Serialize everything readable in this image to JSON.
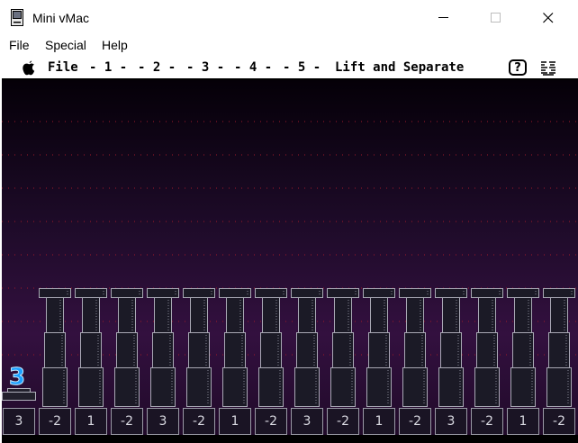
{
  "window": {
    "title": "Mini vMac",
    "minimize_glyph": "—",
    "maximize_glyph": "☐",
    "close_glyph": "✕"
  },
  "menubar": {
    "items": [
      "File",
      "Special",
      "Help"
    ]
  },
  "mac_menubar": {
    "apple_icon": "apple-icon",
    "file": "File",
    "levels": [
      "- 1 -",
      "- 2 -",
      "- 3 -",
      "- 4 -",
      "- 5 -"
    ],
    "game_title": "Lift and Separate",
    "help_glyph": "?"
  },
  "game": {
    "current_marker": "3",
    "start_label": "3",
    "peg_labels": [
      "-2",
      "1",
      "-2",
      "3",
      "-2",
      "1",
      "-2",
      "3",
      "-2",
      "1",
      "-2",
      "3",
      "-2",
      "1",
      "-2"
    ],
    "colors": {
      "background_top": "#050008",
      "background_bottom": "#33103f",
      "grid_dots": "#a01a2a",
      "marker": "#1aa0ff"
    }
  }
}
